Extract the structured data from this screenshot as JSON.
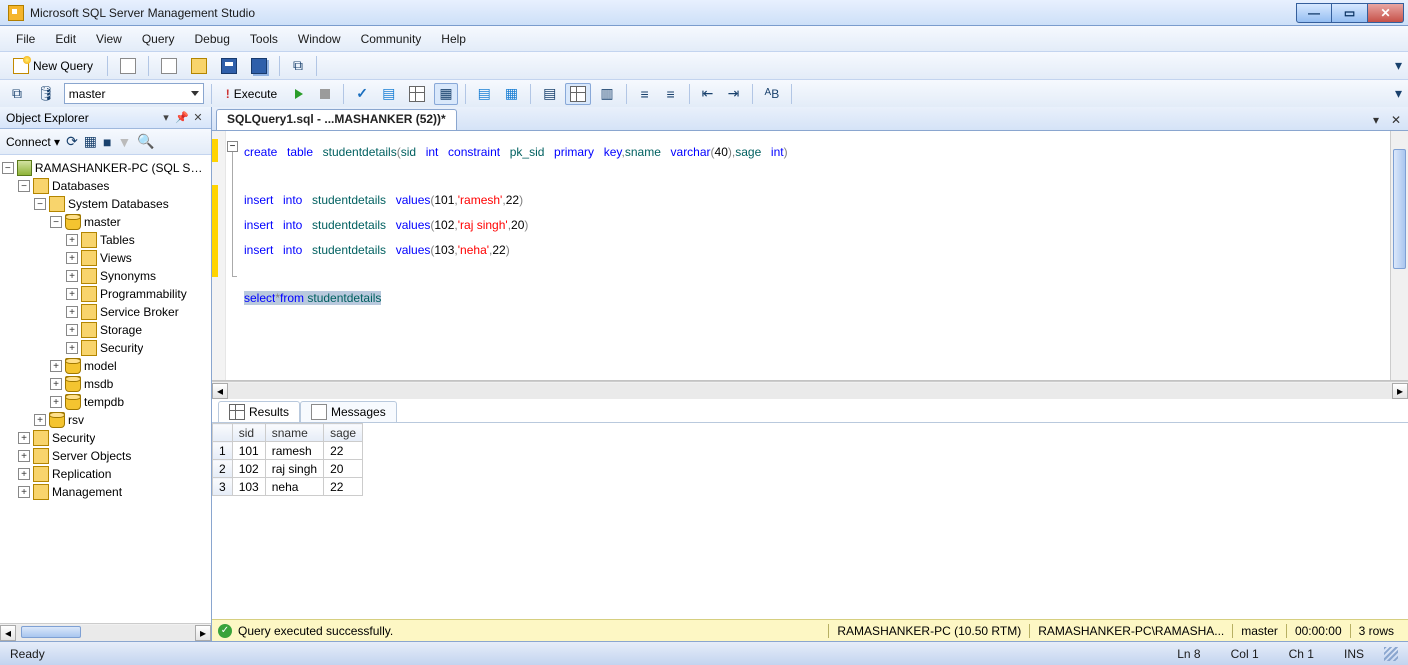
{
  "title": "Microsoft SQL Server Management Studio",
  "menubar": [
    "File",
    "Edit",
    "View",
    "Query",
    "Debug",
    "Tools",
    "Window",
    "Community",
    "Help"
  ],
  "toolbar1": {
    "newquery": "New Query"
  },
  "toolbar2": {
    "db": "master",
    "execute": "Execute"
  },
  "objexp": {
    "title": "Object Explorer",
    "connect": "Connect",
    "root": "RAMASHANKER-PC (SQL Server",
    "databases": "Databases",
    "sysdb": "System Databases",
    "dbs": [
      "master",
      "model",
      "msdb",
      "tempdb"
    ],
    "master_children": [
      "Tables",
      "Views",
      "Synonyms",
      "Programmability",
      "Service Broker",
      "Storage",
      "Security"
    ],
    "userdb": "rsv",
    "server_nodes": [
      "Security",
      "Server Objects",
      "Replication",
      "Management"
    ]
  },
  "doc_tab": "SQLQuery1.sql - ...MASHANKER (52))*",
  "sql": {
    "tokens0": [
      [
        "kw",
        "create"
      ],
      [
        "sp",
        " "
      ],
      [
        "kw",
        "table"
      ],
      [
        "sp",
        " "
      ],
      [
        "ident",
        "studentdetails"
      ],
      [
        "gray",
        "("
      ],
      [
        "ident",
        "sid"
      ],
      [
        "sp",
        " "
      ],
      [
        "kw",
        "int"
      ],
      [
        "sp",
        " "
      ],
      [
        "kw",
        "constraint"
      ],
      [
        "sp",
        " "
      ],
      [
        "ident",
        "pk_sid"
      ],
      [
        "sp",
        " "
      ],
      [
        "kw",
        "primary"
      ],
      [
        "sp",
        " "
      ],
      [
        "kw",
        "key"
      ],
      [
        "gray",
        ","
      ],
      [
        "ident",
        "sname"
      ],
      [
        "sp",
        " "
      ],
      [
        "kw",
        "varchar"
      ],
      [
        "gray",
        "("
      ],
      [
        "num",
        "40"
      ],
      [
        "gray",
        ")"
      ],
      [
        "gray",
        ","
      ],
      [
        "ident",
        "sage"
      ],
      [
        "sp",
        " "
      ],
      [
        "kw",
        "int"
      ],
      [
        "gray",
        ")"
      ]
    ],
    "tokens2": [
      [
        "kw",
        "insert"
      ],
      [
        "sp",
        " "
      ],
      [
        "kw",
        "into"
      ],
      [
        "sp",
        " "
      ],
      [
        "ident",
        "studentdetails"
      ],
      [
        "sp",
        " "
      ],
      [
        "kw",
        "values"
      ],
      [
        "gray",
        "("
      ],
      [
        "num",
        "101"
      ],
      [
        "gray",
        ","
      ],
      [
        "str",
        "'ramesh'"
      ],
      [
        "gray",
        ","
      ],
      [
        "num",
        "22"
      ],
      [
        "gray",
        ")"
      ]
    ],
    "tokens3": [
      [
        "kw",
        "insert"
      ],
      [
        "sp",
        " "
      ],
      [
        "kw",
        "into"
      ],
      [
        "sp",
        " "
      ],
      [
        "ident",
        "studentdetails"
      ],
      [
        "sp",
        " "
      ],
      [
        "kw",
        "values"
      ],
      [
        "gray",
        "("
      ],
      [
        "num",
        "102"
      ],
      [
        "gray",
        ","
      ],
      [
        "str",
        "'raj singh'"
      ],
      [
        "gray",
        ","
      ],
      [
        "num",
        "20"
      ],
      [
        "gray",
        ")"
      ]
    ],
    "tokens4": [
      [
        "kw",
        "insert"
      ],
      [
        "sp",
        " "
      ],
      [
        "kw",
        "into"
      ],
      [
        "sp",
        " "
      ],
      [
        "ident",
        "studentdetails"
      ],
      [
        "sp",
        " "
      ],
      [
        "kw",
        "values"
      ],
      [
        "gray",
        "("
      ],
      [
        "num",
        "103"
      ],
      [
        "gray",
        ","
      ],
      [
        "str",
        "'neha'"
      ],
      [
        "gray",
        ","
      ],
      [
        "num",
        "22"
      ],
      [
        "gray",
        ")"
      ]
    ],
    "tokens6": [
      [
        "kw",
        "select"
      ],
      [
        "gray",
        "*"
      ],
      [
        "kw",
        "from"
      ],
      [
        "sp",
        " "
      ],
      [
        "ident",
        "studentdetails"
      ]
    ]
  },
  "results": {
    "tab_results": "Results",
    "tab_messages": "Messages",
    "columns": [
      "sid",
      "sname",
      "sage"
    ],
    "rows": [
      {
        "n": "1",
        "sid": "101",
        "sname": "ramesh",
        "sage": "22"
      },
      {
        "n": "2",
        "sid": "102",
        "sname": "raj singh",
        "sage": "20"
      },
      {
        "n": "3",
        "sid": "103",
        "sname": "neha",
        "sage": "22"
      }
    ]
  },
  "querystatus": {
    "msg": "Query executed successfully.",
    "server": "RAMASHANKER-PC (10.50 RTM)",
    "user": "RAMASHANKER-PC\\RAMASHA...",
    "db": "master",
    "elapsed": "00:00:00",
    "rows": "3 rows"
  },
  "appstatus": {
    "left": "Ready",
    "ln": "Ln 8",
    "col": "Col 1",
    "ch": "Ch 1",
    "ins": "INS"
  }
}
